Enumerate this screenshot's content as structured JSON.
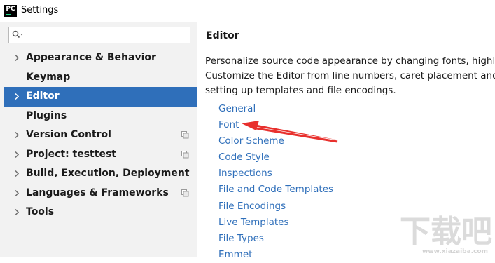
{
  "window": {
    "title": "Settings",
    "app_icon_text": "PC"
  },
  "search": {
    "value": "",
    "placeholder": ""
  },
  "sidebar": {
    "items": [
      {
        "label": "Appearance & Behavior",
        "expandable": true,
        "project_icon": false
      },
      {
        "label": "Keymap",
        "expandable": false,
        "project_icon": false
      },
      {
        "label": "Editor",
        "expandable": true,
        "project_icon": false,
        "selected": true
      },
      {
        "label": "Plugins",
        "expandable": false,
        "project_icon": false
      },
      {
        "label": "Version Control",
        "expandable": true,
        "project_icon": true
      },
      {
        "label": "Project: testtest",
        "expandable": true,
        "project_icon": true
      },
      {
        "label": "Build, Execution, Deployment",
        "expandable": true,
        "project_icon": false
      },
      {
        "label": "Languages & Frameworks",
        "expandable": true,
        "project_icon": true
      },
      {
        "label": "Tools",
        "expandable": true,
        "project_icon": false
      }
    ]
  },
  "main": {
    "heading": "Editor",
    "description": [
      "Personalize source code appearance by changing fonts, highligh",
      "Customize the Editor from line numbers, caret placement and tab",
      "setting up templates and file encodings."
    ],
    "links": [
      "General",
      "Font",
      "Color Scheme",
      "Code Style",
      "Inspections",
      "File and Code Templates",
      "File Encodings",
      "Live Templates",
      "File Types",
      "Emmet"
    ]
  },
  "annotation": {
    "arrow_target": "Font",
    "arrow_color": "#e8302d"
  },
  "watermark": {
    "text": "下载吧",
    "subtext": "www.xiazaiba.com"
  },
  "colors": {
    "selection": "#2f6fba",
    "link": "#2f6fba",
    "sidebar_bg": "#f2f2f2"
  }
}
